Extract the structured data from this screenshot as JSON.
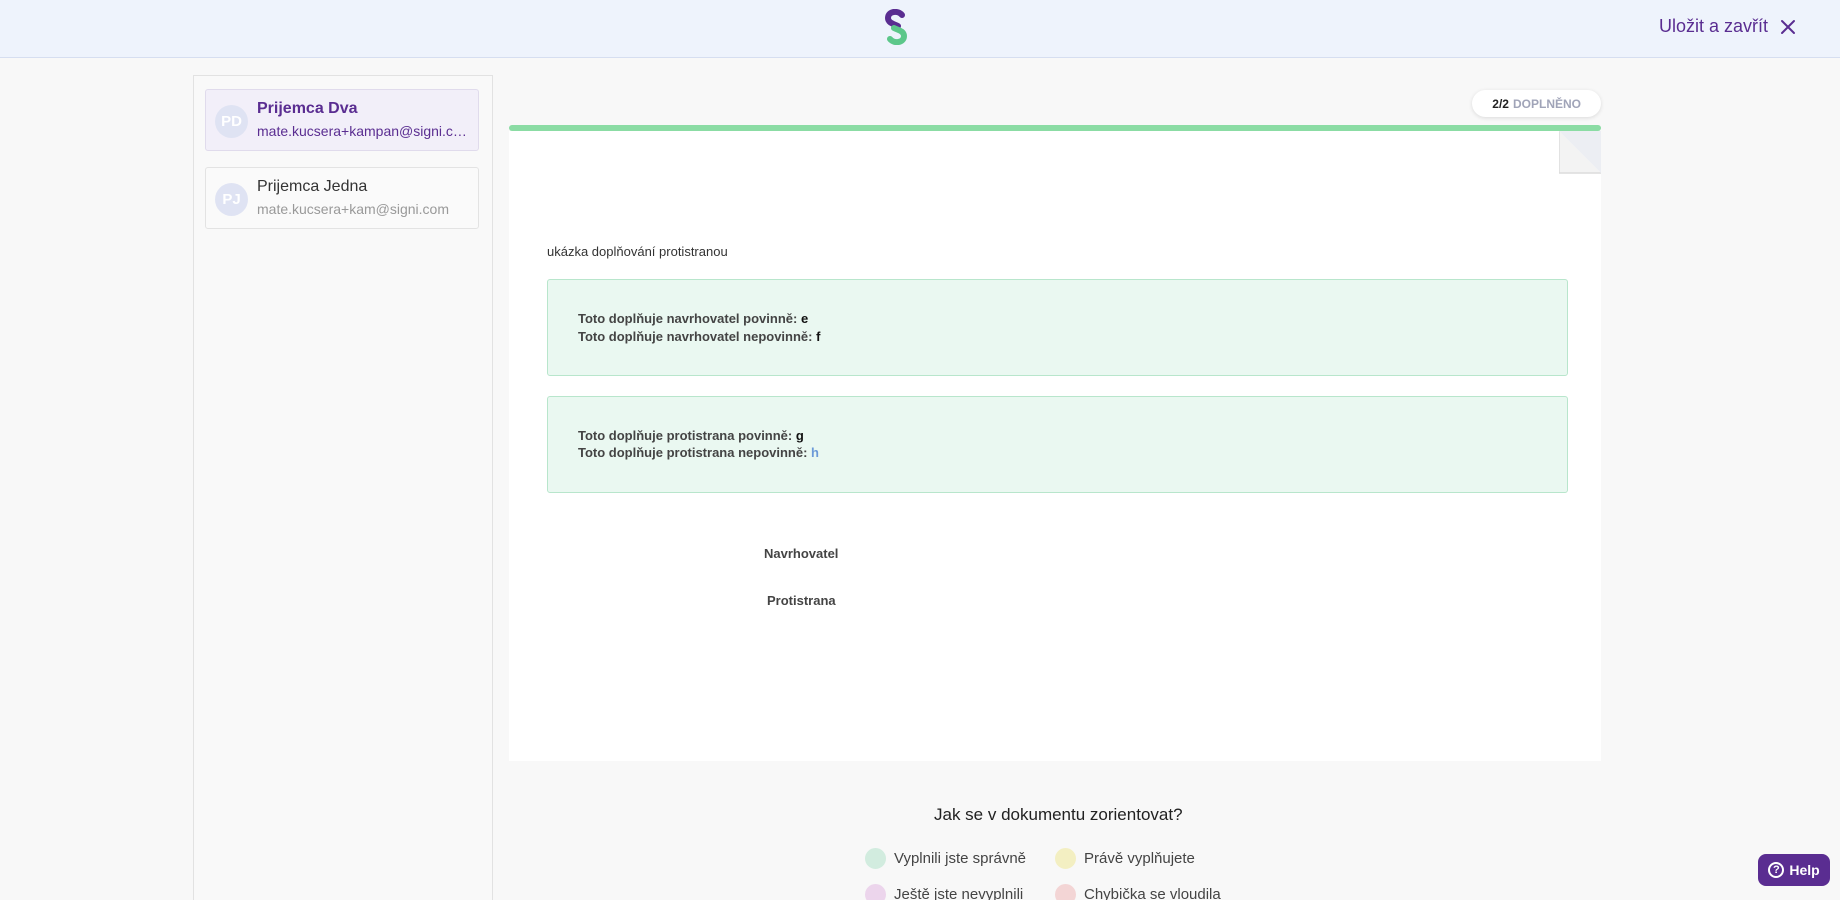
{
  "header": {
    "logo_icon": "signi-logo-icon",
    "save_close_label": "Uložit a zavřít",
    "close_icon": "close-icon",
    "brand_color": "#5a2d91"
  },
  "sidebar": {
    "recipients": [
      {
        "initials": "PD",
        "name": "Prijemca Dva",
        "email": "mate.kucsera+kampan@signi.com",
        "active": true
      },
      {
        "initials": "PJ",
        "name": "Prijemca Jedna",
        "email": "mate.kucsera+kam@signi.com",
        "active": false
      }
    ]
  },
  "status": {
    "count": "2/2",
    "label": "DOPLNĚNO",
    "progress": 1.0,
    "progress_color": "#8bdca4"
  },
  "document": {
    "title": "ukázka doplňování protistranou",
    "box1": {
      "line1_label": "Toto doplňuje navrhovatel povinně:",
      "line1_value": "e",
      "line2_label": "Toto doplňuje navrhovatel nepovinně:",
      "line2_value": "f"
    },
    "box2": {
      "line1_label": "Toto doplňuje protistrana povinně:",
      "line1_value": "g",
      "line2_label": "Toto doplňuje protistrana nepovinně:",
      "line2_value": "h"
    },
    "signature1": "Navrhovatel",
    "signature2": "Protistrana"
  },
  "legend": {
    "title": "Jak se v dokumentu zorientovat?",
    "items": [
      {
        "label": "Vyplnili jste správně",
        "color": "#d8f3e6"
      },
      {
        "label": "Právě vyplňujete",
        "color": "#fbf6c8"
      },
      {
        "label": "Ještě jste nevyplnili",
        "color": "#f3dcf3"
      },
      {
        "label": "Chybička se vloudila",
        "color": "#fbdcdc"
      }
    ]
  },
  "help": {
    "label": "Help",
    "icon": "question-icon"
  }
}
